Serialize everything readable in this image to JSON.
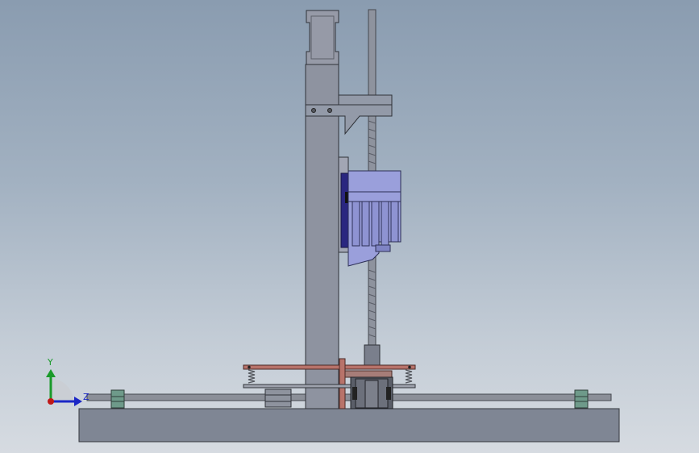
{
  "viewport": {
    "background_top": "#8a9cb0",
    "background_bottom": "#d6dbe1"
  },
  "model": {
    "base_color": "#7f8694",
    "column_color": "#8e93a0",
    "carriage_color": "#9a9fdb",
    "motor_color": "#2a2680",
    "screw_color": "#8e939e",
    "rail_color": "#8b8f98",
    "bushing_color": "#6e9a8a",
    "plate_color": "#b8736a",
    "spring_color": "#9a9aa0"
  },
  "triad": {
    "y_label": "Y",
    "z_label": "Z",
    "y_color": "#1a9a2a",
    "z_color": "#1b27c6",
    "x_color": "#c01818"
  }
}
